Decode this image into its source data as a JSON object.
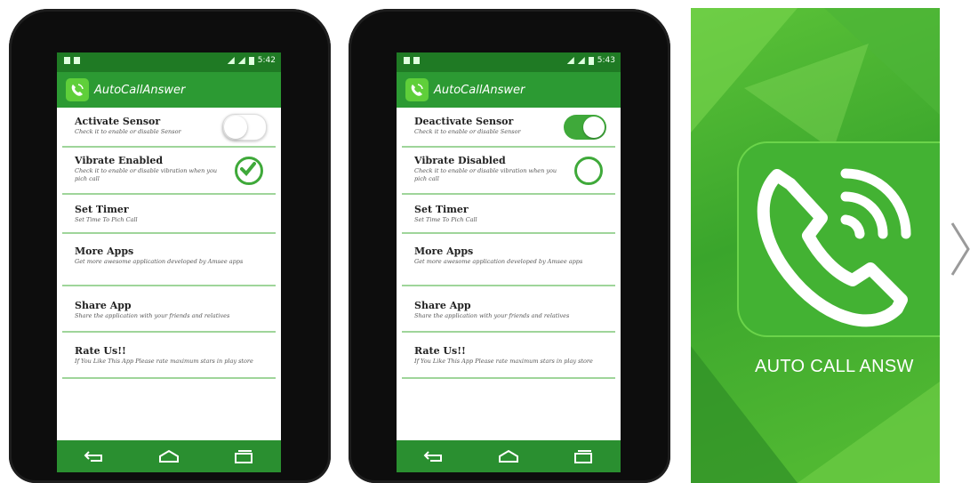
{
  "colors": {
    "status_bar": "#1f7a24",
    "action_bar": "#2c9a33",
    "accent": "#3fa93a",
    "divider": "#9fd59a",
    "nav_bar": "#2a8f30"
  },
  "app": {
    "title": "AutoCallAnswer"
  },
  "screens": [
    {
      "status_time": "5:42",
      "rows": [
        {
          "title": "Activate Sensor",
          "subtitle": "Check it to enable or disable Sensor",
          "control": "toggle",
          "state": "off"
        },
        {
          "title": "Vibrate Enabled",
          "subtitle": "Check it to enable or disable vibration when you pich call",
          "control": "checkbox",
          "state": "checked"
        },
        {
          "title": "Set Timer",
          "subtitle": "Set Time To Pich Call"
        },
        {
          "title": "More Apps",
          "subtitle": "Get more awesome application developed by Amsee apps"
        },
        {
          "title": "Share App",
          "subtitle": "Share the application with your friends and relatives"
        },
        {
          "title": "Rate Us!!",
          "subtitle": "If You Like This App Please rate maximum stars in play store"
        }
      ],
      "nav_icons": [
        "back-icon",
        "home-icon",
        "recents-icon"
      ]
    },
    {
      "status_time": "5:43",
      "rows": [
        {
          "title": "Deactivate Sensor",
          "subtitle": "Check it to enable or disable Sensor",
          "control": "toggle",
          "state": "on"
        },
        {
          "title": "Vibrate Disabled",
          "subtitle": "Check it to enable or disable vibration when you pich call",
          "control": "checkbox",
          "state": "unchecked"
        },
        {
          "title": "Set Timer",
          "subtitle": "Set Time To Pich Call"
        },
        {
          "title": "More Apps",
          "subtitle": "Get more awesome application developed by Amsee apps"
        },
        {
          "title": "Share App",
          "subtitle": "Share the application with your friends and relatives"
        },
        {
          "title": "Rate Us!!",
          "subtitle": "If You Like This App Please rate maximum stars in play store"
        }
      ],
      "nav_icons": [
        "back-icon",
        "home-icon",
        "recents-icon"
      ]
    }
  ],
  "promo": {
    "label": "AUTO CALL ANSW",
    "icon": "phone-call-icon"
  },
  "carousel": {
    "next_icon": "chevron-right-icon"
  }
}
